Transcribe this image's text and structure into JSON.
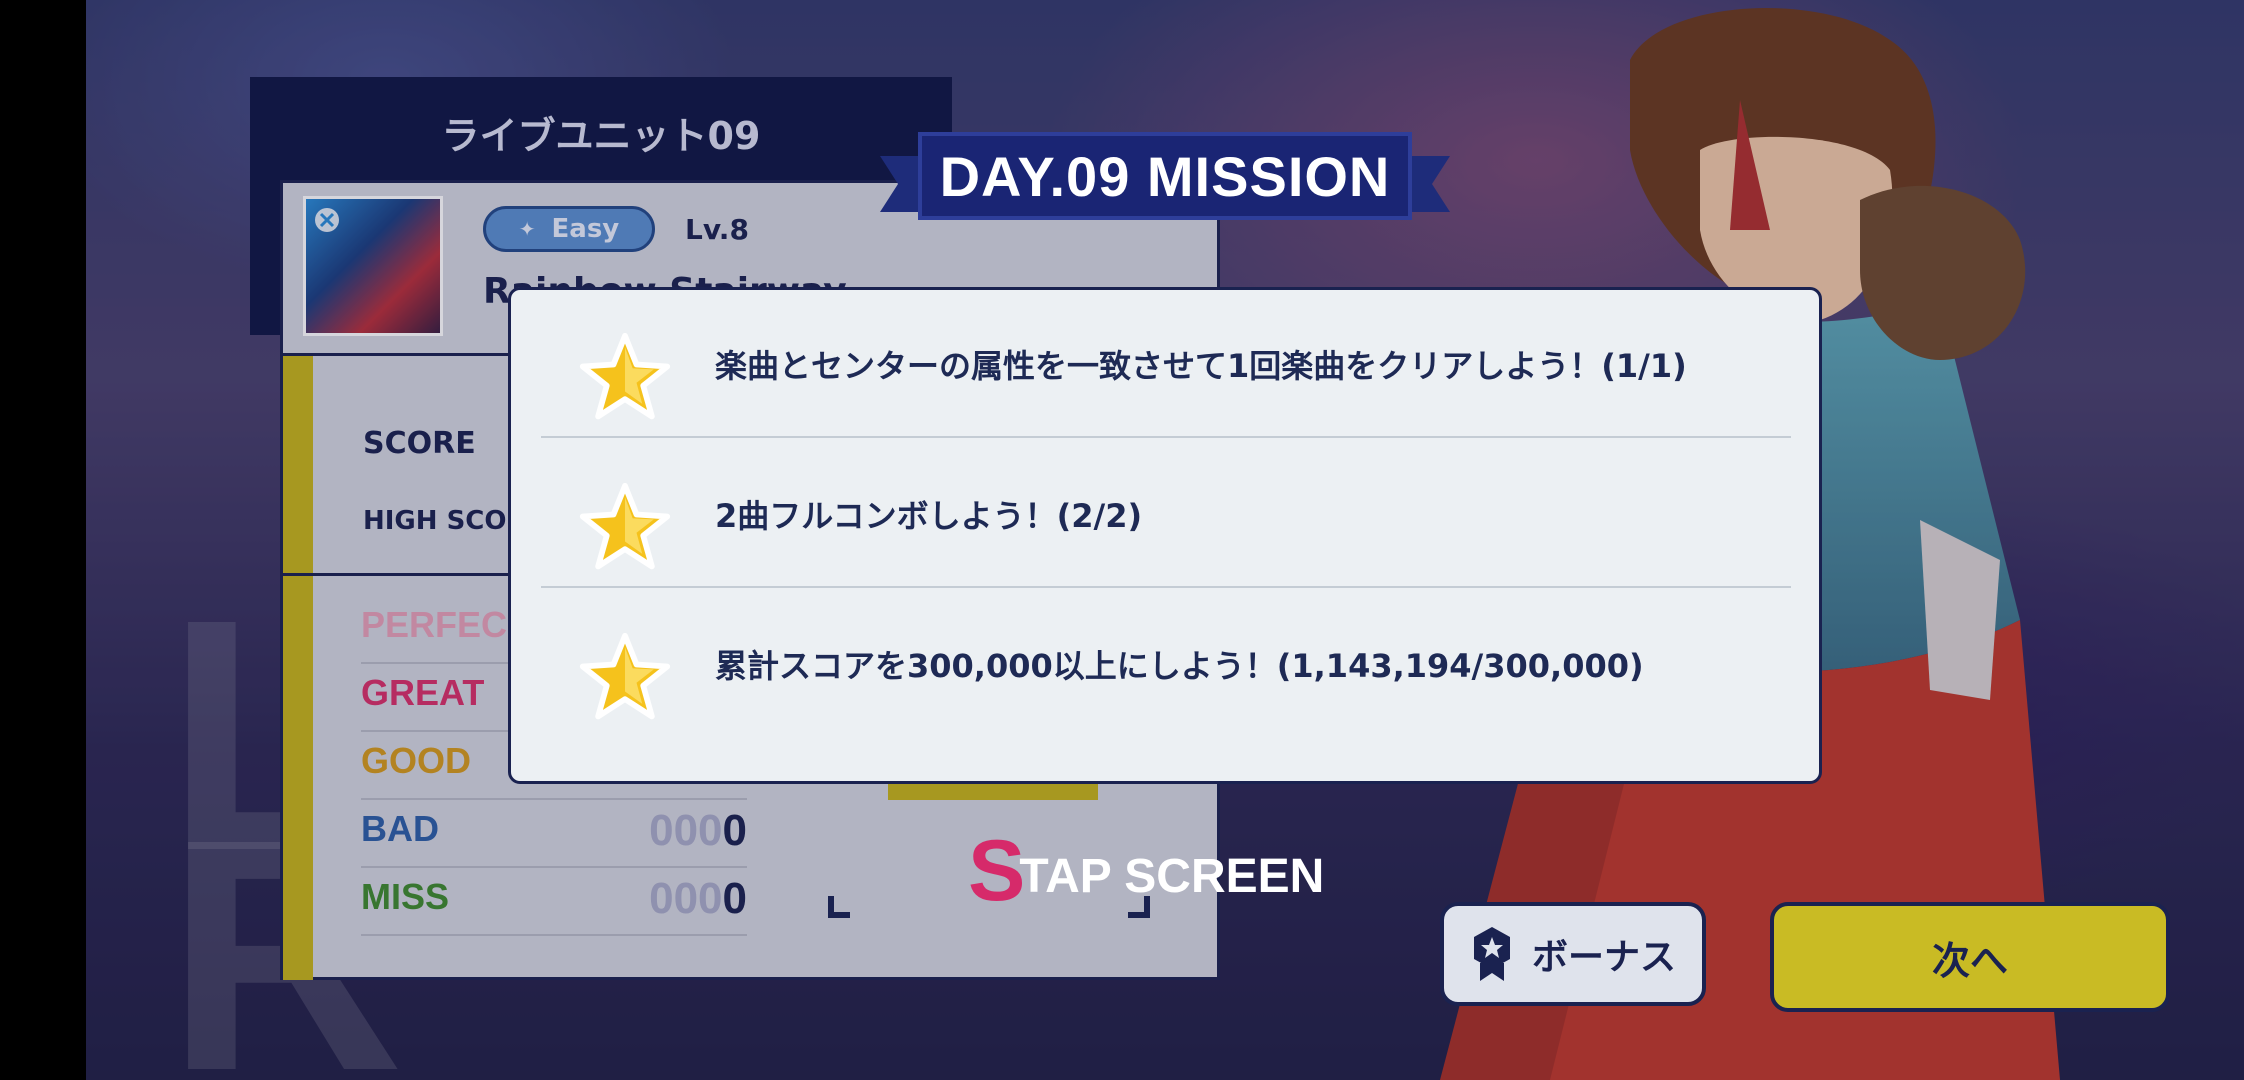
{
  "background": {
    "word_line1": "L",
    "word_line2": "R"
  },
  "result": {
    "unit_title": "ライブユニット09",
    "difficulty": "Easy",
    "level": "Lv.8",
    "song_title": "Rainbow Stairway",
    "score_label": "SCORE",
    "high_score_label": "HIGH SCO",
    "judgements": [
      {
        "name": "PERFEC",
        "color": "#e7a0b8",
        "dim": "",
        "value": ""
      },
      {
        "name": "GREAT",
        "color": "#d8306a",
        "dim": "",
        "value": ""
      },
      {
        "name": "GOOD",
        "color": "#d59a1c",
        "dim": "",
        "value": ""
      },
      {
        "name": "BAD",
        "color": "#2d5fa6",
        "dim": "000",
        "value": "0"
      },
      {
        "name": "MISS",
        "color": "#3f8a2e",
        "dim": "000",
        "value": "0"
      }
    ]
  },
  "tap_screen": {
    "s": "S",
    "text": "TAP SCREEN"
  },
  "mission": {
    "banner": "DAY.09 MISSION",
    "items": [
      {
        "icon": "star-icon",
        "text": "楽曲とセンターの属性を一致させて1回楽曲をクリアしよう！(1/1)"
      },
      {
        "icon": "star-icon",
        "text": "2曲フルコンボしよう！(2/2)"
      },
      {
        "icon": "star-icon",
        "text": "累計スコアを300,000以上にしよう！(1,143,194/300,000)"
      }
    ]
  },
  "buttons": {
    "bonus": "ボーナス",
    "next": "次へ"
  },
  "colors": {
    "navy": "#1a2250",
    "accent_yellow": "#c9bb24",
    "star": "#f5c21c"
  }
}
